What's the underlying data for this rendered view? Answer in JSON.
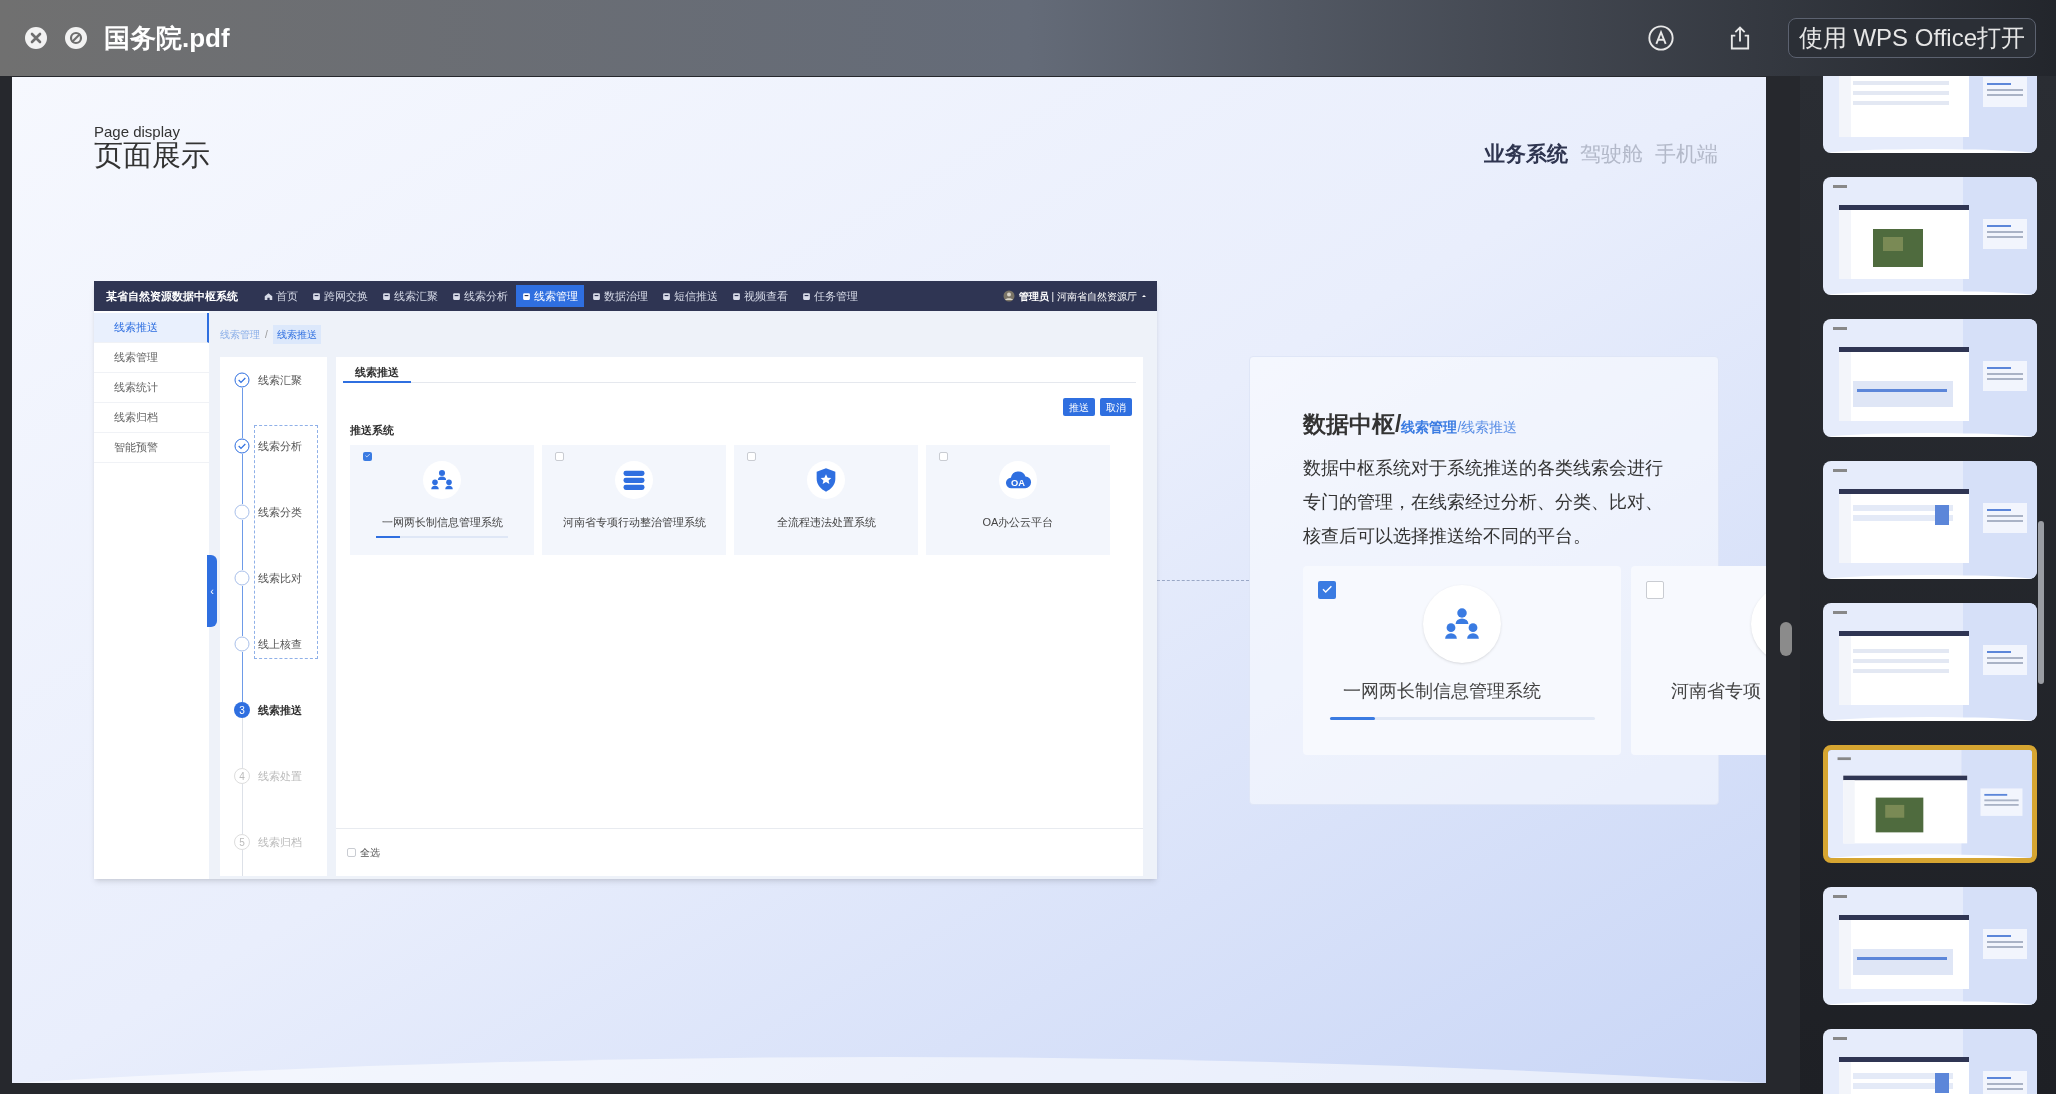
{
  "window": {
    "title": "国务院.pdf",
    "open_button": "使用 WPS Office打开"
  },
  "slide": {
    "subtitle": "Page display",
    "title": "页面展示",
    "tabs": [
      {
        "label": "业务系统",
        "selected": true
      },
      {
        "label": "驾驶舱",
        "selected": false
      },
      {
        "label": "手机端",
        "selected": false
      }
    ],
    "app": {
      "system_name": "某省自然资源数据中枢系统",
      "nav": [
        {
          "label": "首页",
          "selected": false
        },
        {
          "label": "跨网交换",
          "selected": false
        },
        {
          "label": "线索汇聚",
          "selected": false
        },
        {
          "label": "线索分析",
          "selected": false
        },
        {
          "label": "线索管理",
          "selected": true
        },
        {
          "label": "数据治理",
          "selected": false
        },
        {
          "label": "短信推送",
          "selected": false
        },
        {
          "label": "视频查看",
          "selected": false
        },
        {
          "label": "任务管理",
          "selected": false
        }
      ],
      "user": "**管理员** | 河南省自然资源厅",
      "sidebar": [
        {
          "label": "线索推送",
          "selected": true
        },
        {
          "label": "线索管理",
          "selected": false
        },
        {
          "label": "线索统计",
          "selected": false
        },
        {
          "label": "线索归档",
          "selected": false
        },
        {
          "label": "智能预警",
          "selected": false
        }
      ],
      "collapse_handle": "‹",
      "breadcrumb_separator": "/",
      "breadcrumb": [
        {
          "label": "线索管理",
          "current": false
        },
        {
          "label": "线索推送",
          "current": true
        }
      ],
      "steps": [
        {
          "label": "线索汇聚",
          "completed": true,
          "current": false,
          "disabled": false,
          "in_frame": false
        },
        {
          "label": "线索分析",
          "completed": true,
          "current": false,
          "disabled": false,
          "in_frame": true
        },
        {
          "label": "线索分类",
          "completed": false,
          "current": false,
          "disabled": false,
          "in_frame": true
        },
        {
          "label": "线索比对",
          "completed": false,
          "current": false,
          "disabled": false,
          "in_frame": true
        },
        {
          "label": "线上核查",
          "completed": false,
          "current": false,
          "disabled": false,
          "in_frame": true
        },
        {
          "label": "线索推送",
          "completed": false,
          "current": true,
          "disabled": false,
          "number": "3",
          "in_frame": false
        },
        {
          "label": "线索处置",
          "completed": false,
          "current": false,
          "disabled": true,
          "number": "4",
          "in_frame": false
        },
        {
          "label": "线索归档",
          "completed": false,
          "current": false,
          "disabled": true,
          "number": "5",
          "in_frame": false
        }
      ],
      "tab": "线索推送",
      "buttons": [
        "推送",
        "取消"
      ],
      "section_label": "推送系统",
      "systems": [
        {
          "name": "一网两长制信息管理系统",
          "checked": true,
          "level": 0.18
        },
        {
          "name": "河南省专项行动整治管理系统",
          "checked": false
        },
        {
          "name": "全流程违法处置系统",
          "checked": false
        },
        {
          "name": "OA办公云平台",
          "checked": false,
          "icon_text": "OA"
        }
      ],
      "select_all": {
        "label": "全选",
        "checked": false
      }
    },
    "callout": {
      "title_parts": [
        {
          "text": "数据中枢/",
          "kind": "main"
        },
        {
          "text": "线索管理",
          "kind": "section"
        },
        {
          "text": "/线索推送",
          "kind": "page"
        }
      ],
      "body": "数据中枢系统对于系统推送的各类线索会进行专门的管理，在线索经过分析、分类、比对、核查后可以选择推送给不同的平台。",
      "systems": [
        {
          "name": "一网两长制信息管理系统",
          "checked": true,
          "level": 0.17
        },
        {
          "name": "河南省专项",
          "checked": false
        }
      ]
    }
  },
  "thumbnails": [
    {
      "selected": false
    },
    {
      "selected": false
    },
    {
      "selected": false
    },
    {
      "selected": false
    },
    {
      "selected": false
    },
    {
      "selected": true
    },
    {
      "selected": false
    },
    {
      "selected": false
    }
  ]
}
